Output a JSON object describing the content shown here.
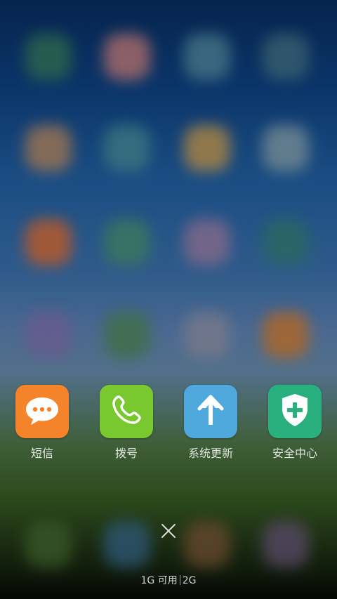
{
  "apps": [
    {
      "label": "短信",
      "icon": "message-bubble-icon",
      "color": "#f5832a"
    },
    {
      "label": "拨号",
      "icon": "phone-icon",
      "color": "#7ac830"
    },
    {
      "label": "系统更新",
      "icon": "arrow-up-icon",
      "color": "#4fa8dc"
    },
    {
      "label": "安全中心",
      "icon": "shield-plus-icon",
      "color": "#2ab07f"
    }
  ],
  "close": {
    "icon": "close-icon"
  },
  "memory": {
    "available": "1G 可用",
    "total": "2G"
  },
  "colors": {
    "wallpaper_top": "#06244d",
    "wallpaper_bottom": "#050805"
  }
}
